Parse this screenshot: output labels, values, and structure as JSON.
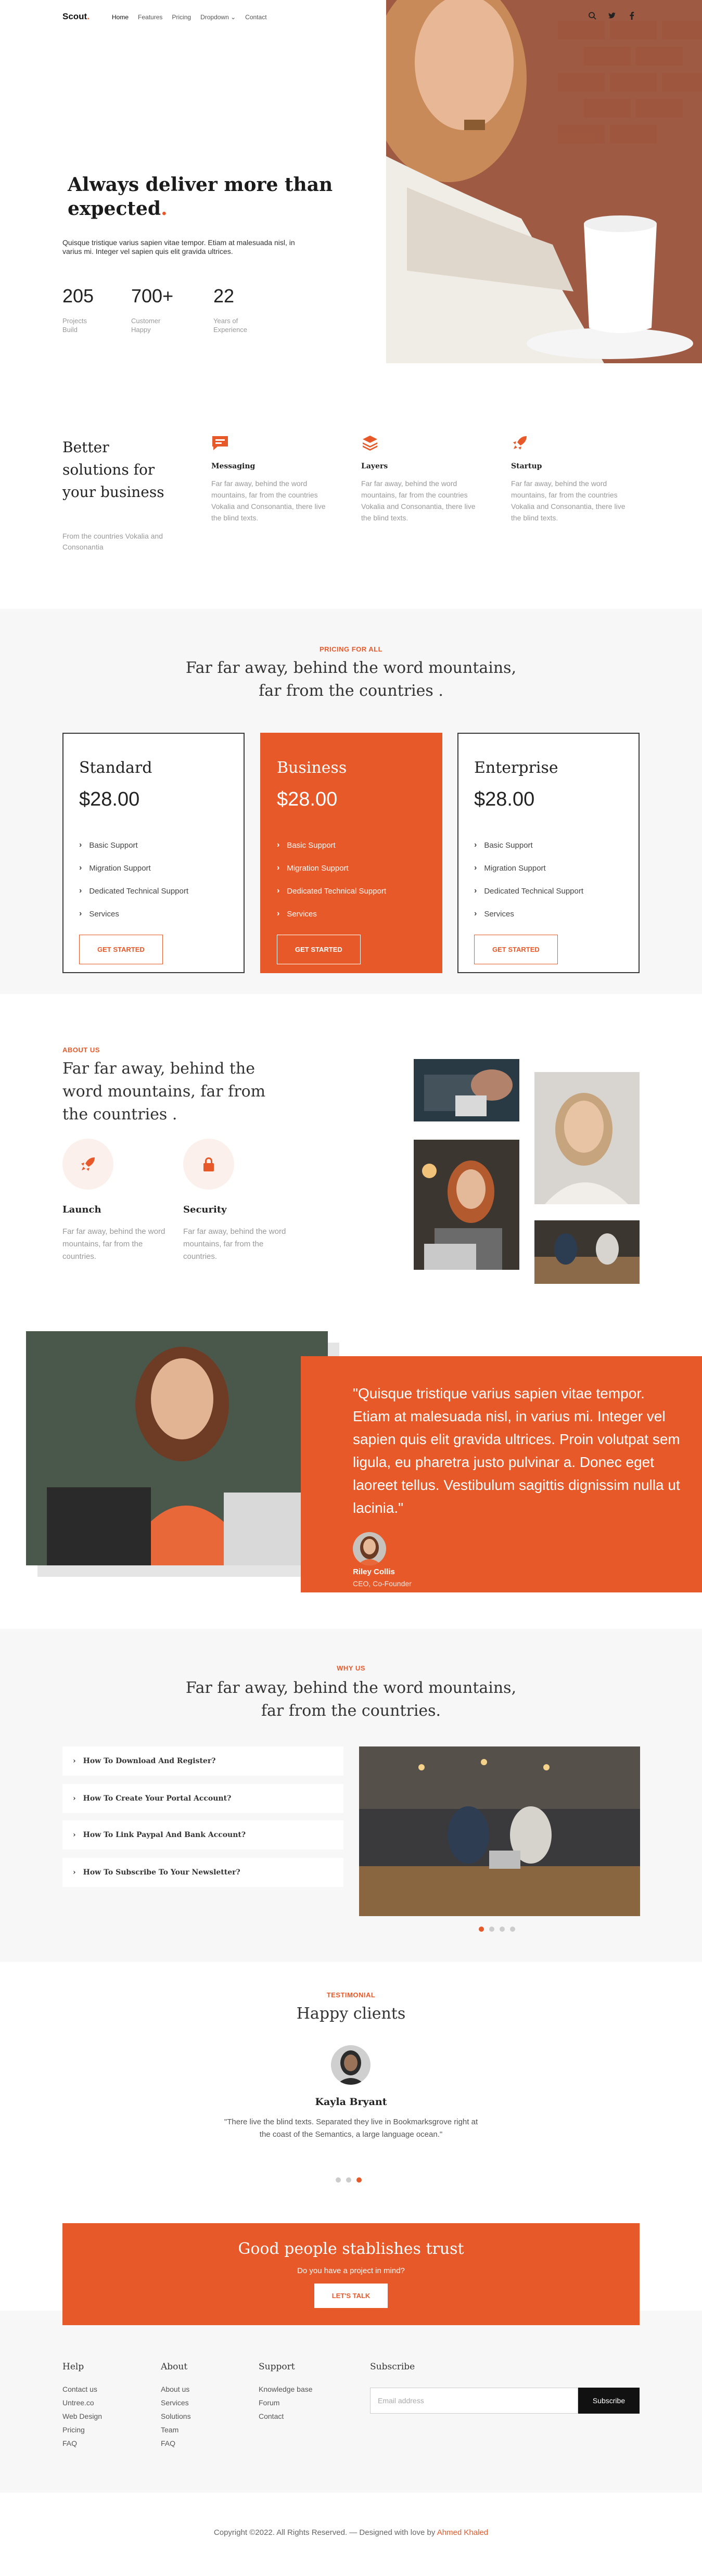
{
  "nav": {
    "logo": "Scout",
    "logo_dot": ".",
    "links": [
      "Home",
      "Features",
      "Pricing",
      "Dropdown",
      "Contact"
    ],
    "social_icons": [
      "search-icon",
      "twitter-icon",
      "facebook-icon"
    ]
  },
  "hero": {
    "title": "Always deliver more than expected",
    "title_dot": ".",
    "text": "Quisque tristique varius sapien vitae tempor. Etiam at malesuada nisl, in varius mi. Integer vel sapien quis elit gravida ultrices.",
    "stats": [
      {
        "num": "205",
        "label1": "Projects",
        "label2": "Build"
      },
      {
        "num": "700+",
        "label1": "Customer",
        "label2": "Happy"
      },
      {
        "num": "22",
        "label1": "Years of",
        "label2": "Experience"
      }
    ]
  },
  "solutions": {
    "title": "Better solutions for your business",
    "subtitle": "From the countries Vokalia and Consonantia",
    "features": [
      {
        "icon": "chat-icon",
        "title": "Messaging",
        "desc": "Far far away, behind the word mountains, far from the countries Vokalia and Consonantia, there live the blind texts."
      },
      {
        "icon": "layers-icon",
        "title": "Layers",
        "desc": "Far far away, behind the word mountains, far from the countries Vokalia and Consonantia, there live the blind texts."
      },
      {
        "icon": "rocket-icon",
        "title": "Startup",
        "desc": "Far far away, behind the word mountains, far from the countries Vokalia and Consonantia, there live the blind texts."
      }
    ]
  },
  "pricing": {
    "kicker": "PRICING FOR ALL",
    "title_line1": "Far far away, behind the word mountains,",
    "title_line2": "far from the countries .",
    "plans": [
      {
        "name": "Standard",
        "price": "$28.00",
        "features": [
          "Basic Support",
          "Migration Support",
          "Dedicated Technical Support",
          "Services"
        ],
        "button": "GET STARTED"
      },
      {
        "name": "Business",
        "price": "$28.00",
        "features": [
          "Basic Support",
          "Migration Support",
          "Dedicated Technical Support",
          "Services"
        ],
        "button": "GET STARTED"
      },
      {
        "name": "Enterprise",
        "price": "$28.00",
        "features": [
          "Basic Support",
          "Migration Support",
          "Dedicated Technical Support",
          "Services"
        ],
        "button": "GET STARTED"
      }
    ]
  },
  "about": {
    "kicker": "ABOUT US",
    "title": "Far far away, behind the word mountains, far from the countries .",
    "items": [
      {
        "icon": "rocket-icon",
        "title": "Launch",
        "desc": "Far far away, behind the word mountains, far from the countries."
      },
      {
        "icon": "lock-icon",
        "title": "Security",
        "desc": "Far far away, behind the word mountains, far from the countries."
      }
    ]
  },
  "quote": {
    "text": "\"Quisque tristique varius sapien vitae tempor. Etiam at malesuada nisl, in varius mi. Integer vel sapien quis elit gravida ultrices. Proin volutpat sem ligula, eu pharetra justo pulvinar a. Donec eget laoreet tellus. Vestibulum sagittis dignissim nulla ut lacinia.\"",
    "name": "Riley Collis",
    "role": "CEO, Co-Founder"
  },
  "why": {
    "kicker": "WHY US",
    "title_line1": "Far far away, behind the word mountains,",
    "title_line2": "far from the countries.",
    "faqs": [
      "How To Download And Register?",
      "How To Create Your Portal Account?",
      "How To Link Paypal And Bank Account?",
      "How To Subscribe To Your Newsletter?"
    ]
  },
  "testimonial": {
    "kicker": "TESTIMONIAL",
    "title": "Happy clients",
    "name": "Kayla Bryant",
    "quote": "\"There live the blind texts. Separated they live in Bookmarksgrove right at the coast of the Semantics, a large language ocean.\""
  },
  "cta": {
    "title": "Good people stablishes trust",
    "subtitle": "Do you have a project in mind?",
    "button": "LET'S TALK"
  },
  "footer": {
    "columns": [
      {
        "heading": "Help",
        "items": [
          "Contact us",
          "Untree.co",
          "Web Design",
          "Pricing",
          "FAQ"
        ]
      },
      {
        "heading": "About",
        "items": [
          "About us",
          "Services",
          "Solutions",
          "Team",
          "FAQ"
        ]
      },
      {
        "heading": "Support",
        "items": [
          "Knowledge base",
          "Forum",
          "Contact"
        ]
      }
    ],
    "subscribe_heading": "Subscribe",
    "email_placeholder": "Email address",
    "subscribe_button": "Subscribe",
    "copyright": "Copyright ©2022. All Rights Reserved. — Designed with love by",
    "author": "Ahmed Khaled"
  },
  "colors": {
    "accent": "#e8592a",
    "light_bg": "#f7f7f8"
  }
}
